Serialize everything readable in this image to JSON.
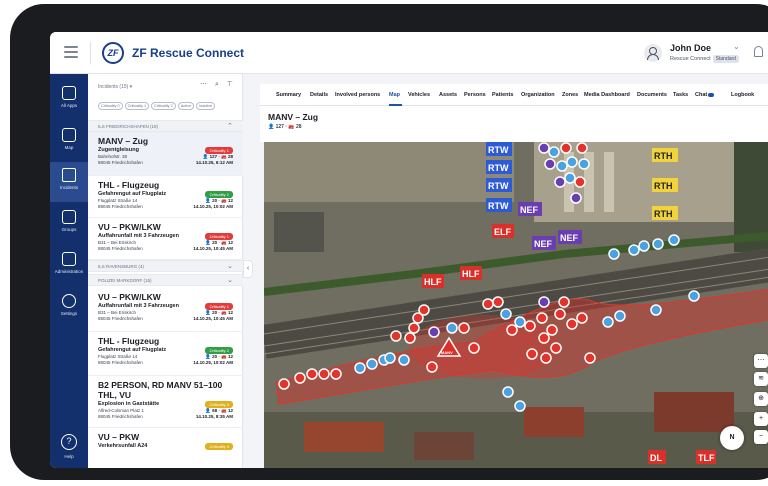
{
  "header": {
    "logo_text": "ZF",
    "app_title": "ZF Rescue Connect",
    "user_name": "John Doe",
    "user_org": "Rescue Connect",
    "user_badge": "Standard"
  },
  "sidebar": {
    "items": [
      {
        "label": "All Apps",
        "icon": "grid-icon"
      },
      {
        "label": "Map",
        "icon": "map-icon"
      },
      {
        "label": "Incidents",
        "icon": "warning-icon"
      },
      {
        "label": "Groups",
        "icon": "folder-icon"
      },
      {
        "label": "Administration",
        "icon": "admin-icon"
      },
      {
        "label": "Settings",
        "icon": "gear-icon"
      }
    ],
    "help_label": "Help",
    "help_glyph": "?"
  },
  "incidents": {
    "title": "Incidents (15) ▾",
    "tools": "⋯ ⌕ ⊤",
    "filters": [
      "Criticality 0",
      "Criticality 1",
      "Criticality 2",
      "Active",
      "Inactive"
    ],
    "groups": [
      {
        "label": "ILS FRIEDRICHSHAFEN (18)",
        "expanded": true
      },
      {
        "label": "ILS RAVENSBURG (4)",
        "expanded": false
      },
      {
        "label": "POLIZEI MARKDORF (15)",
        "expanded": true
      }
    ],
    "items": [
      {
        "title": "MANV – Zug",
        "subtitle": "Zugentgleisung",
        "addr1": "Bahnhofstr. 38",
        "addr2": "88045 Friedrichshafen",
        "criticality": "Criticality 1",
        "crit_color": "#e23b3b",
        "persons": "127",
        "vehicles": "28",
        "time": "14.10.25, 6:12 AM"
      },
      {
        "title": "THL - Flugzeug",
        "subtitle": "Gefahrengut auf Flugplatz",
        "addr1": "Flugplatz Straße 14",
        "addr2": "88045 Friedrichshafen",
        "criticality": "Criticality 2",
        "crit_color": "#2f9e44",
        "persons": "20",
        "vehicles": "12",
        "time": "14.10.25, 10:02 AM"
      },
      {
        "title": "VU – PKW/LKW",
        "subtitle": "Auffahrunfall mit 3 Fahrzeugen",
        "addr1": "B31 – Bei Eriskirch",
        "addr2": "88045 Friedrichshafen",
        "criticality": "Criticality 1",
        "crit_color": "#e23b3b",
        "persons": "20",
        "vehicles": "12",
        "time": "14.10.25, 10:45 AM"
      },
      {
        "title": "VU – PKW/LKW",
        "subtitle": "Auffahrunfall mit 3 Fahrzeugen",
        "addr1": "B31 – Bei Eriskirch",
        "addr2": "88045 Friedrichshafen",
        "criticality": "Criticality 1",
        "crit_color": "#e23b3b",
        "persons": "20",
        "vehicles": "12",
        "time": "14.10.25, 10:45 AM"
      },
      {
        "title": "THL - Flugzeug",
        "subtitle": "Gefahrengut auf Flugplatz",
        "addr1": "Flugplatz Straße 14",
        "addr2": "88045 Friedrichshafen",
        "criticality": "Criticality 2",
        "crit_color": "#2f9e44",
        "persons": "20",
        "vehicles": "12",
        "time": "14.10.25, 10:02 AM"
      },
      {
        "title": "B2 PERSON, RD MANV 51–100 THL, VU",
        "subtitle": "Explosion in Gaststätte",
        "addr1": "Alfred-Colsman Platz 1",
        "addr2": "88045 Friedrichshafen",
        "criticality": "Criticality 3",
        "crit_color": "#e0b11d",
        "persons": "68",
        "vehicles": "12",
        "time": "14.10.25, 8:35 AM"
      },
      {
        "title": "VU – PKW",
        "subtitle": "Verkehrsunfall A24",
        "addr1": "",
        "addr2": "",
        "criticality": "Criticality 3",
        "crit_color": "#e0b11d",
        "persons": "",
        "vehicles": "",
        "time": ""
      }
    ],
    "fab": "+"
  },
  "tabs": [
    "Summary",
    "Details",
    "Involved persons",
    "Map",
    "Vehicles",
    "Assets",
    "Persons",
    "Patients",
    "Organization",
    "Zones",
    "Media Dashboard",
    "Documents",
    "Tasks",
    "Chat",
    "Logbook"
  ],
  "active_tab": "Map",
  "main": {
    "title": "MANV – Zug",
    "persons": "127",
    "vehicles": "28"
  },
  "map": {
    "labels_blue": [
      "RTW",
      "RTW",
      "RTW",
      "RTW"
    ],
    "labels_purple": [
      "NEF",
      "NEF",
      "NEF"
    ],
    "labels_yellow": [
      "RTH",
      "RTH",
      "RTH"
    ],
    "labels_red": [
      "ELF",
      "HLF",
      "HLF",
      "MANV",
      "DL",
      "TLF"
    ],
    "compass": "N",
    "controls": [
      "⋯",
      "≋",
      "⊕",
      "+",
      "−"
    ]
  }
}
